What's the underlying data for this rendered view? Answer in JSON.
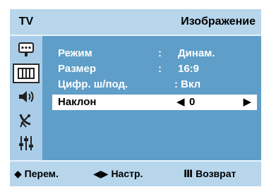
{
  "header": {
    "source": "TV",
    "title": "Изображение"
  },
  "sidebar": {
    "icons": [
      "input-icon",
      "picture-icon",
      "sound-icon",
      "channel-antenna-icon",
      "setup-sliders-icon"
    ],
    "selected_index": 1
  },
  "menu": {
    "items": [
      {
        "label": "Режим",
        "separator": ":",
        "value": "Динам."
      },
      {
        "label": "Размер",
        "separator": ":",
        "value": "16:9"
      },
      {
        "label": "Цифр. ш/под.",
        "separator": "",
        "value": ": Вкл"
      },
      {
        "label": "Наклон",
        "separator": "",
        "value": "0",
        "arrow_left": "◀",
        "arrow_right": "▶"
      }
    ],
    "selected_index": 3
  },
  "footer": {
    "move": {
      "glyph": "◆",
      "label": "Перем."
    },
    "adjust": {
      "glyph": "◀▶",
      "label": "Настр."
    },
    "return": {
      "glyph": "Ⅲ",
      "label": "Возврат"
    }
  },
  "colors": {
    "panel": "#5e9ec8",
    "bars": "#b7d6ec",
    "sidebar": "#a9cde8",
    "highlight": "#ffffff"
  }
}
